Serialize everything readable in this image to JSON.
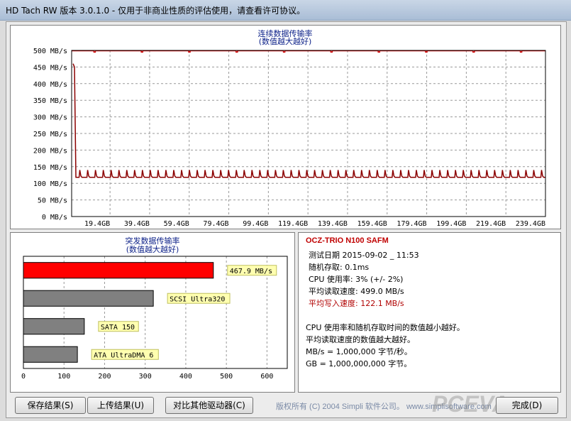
{
  "window": {
    "title": "HD Tach RW 版本 3.0.1.0  - 仅用于非商业性质的评估使用，请查看许可协议。"
  },
  "sequential": {
    "title_line1": "连续数据传输率",
    "title_line2": "(数值越大越好)"
  },
  "burst": {
    "title_line1": "突发数据传输率",
    "title_line2": "(数值越大越好)"
  },
  "info": {
    "drive_name": "OCZ-TRIO N100 SAFM",
    "test_date": "测试日期 2015-09-02 _ 11:53",
    "random_access": "随机存取: 0.1ms",
    "cpu_usage": "CPU 使用率: 3% (+/- 2%)",
    "avg_read": "平均读取速度: 499.0 MB/s",
    "avg_write": "平均写入速度: 122.1 MB/s",
    "note1": "CPU 使用率和随机存取时间的数值越小越好。",
    "note2": "平均读取速度的数值越大越好。",
    "note3": "MB/s = 1,000,000 字节/秒。",
    "note4": "GB = 1,000,000,000 字节。"
  },
  "buttons": {
    "save": "保存结果(S)",
    "upload": "上传结果(U)",
    "compare": "对比其他驱动器(C)",
    "done": "完成(D)"
  },
  "copyright": "版权所有 (C) 2004 Simpli 软件公司。 www.simplisoftware.com",
  "watermark": "PCEVA",
  "colors": {
    "read_line": "#cc0000",
    "write_line": "#8b0000",
    "grid": "#999999",
    "title_blue": "#10248a"
  },
  "chart_data": [
    {
      "type": "line",
      "title": "连续数据传输率 (数值越大越好)",
      "ylim": [
        0,
        500
      ],
      "y_ticks": [
        "0 MB/s",
        "50 MB/s",
        "100 MB/s",
        "150 MB/s",
        "200 MB/s",
        "250 MB/s",
        "300 MB/s",
        "350 MB/s",
        "400 MB/s",
        "450 MB/s",
        "500 MB/s"
      ],
      "x_ticks": [
        "19.4GB",
        "39.4GB",
        "59.4GB",
        "79.4GB",
        "99.4GB",
        "119.4GB",
        "139.4GB",
        "159.4GB",
        "179.4GB",
        "199.4GB",
        "219.4GB",
        "239.4GB"
      ],
      "x_unit": "GB",
      "xlim": [
        0,
        239.4
      ],
      "grid": true,
      "series": [
        {
          "name": "read",
          "baseline": 499,
          "dips_to": 495
        },
        {
          "name": "write",
          "start": 460,
          "baseline": 118,
          "spike": 140,
          "spike_count": 60
        }
      ]
    },
    {
      "type": "bar",
      "title": "突发数据传输率 (数值越大越好)",
      "categories": [
        "467.9 MB/s",
        "SCSI Ultra320",
        "SATA 150",
        "ATA UltraDMA 6"
      ],
      "values": [
        467.9,
        320,
        150,
        133
      ],
      "bar_colors": [
        "#ff0000",
        "#808080",
        "#808080",
        "#808080"
      ],
      "x_ticks": [
        "0",
        "100",
        "200",
        "300",
        "400",
        "500",
        "600"
      ],
      "xlim": [
        0,
        650
      ]
    }
  ]
}
